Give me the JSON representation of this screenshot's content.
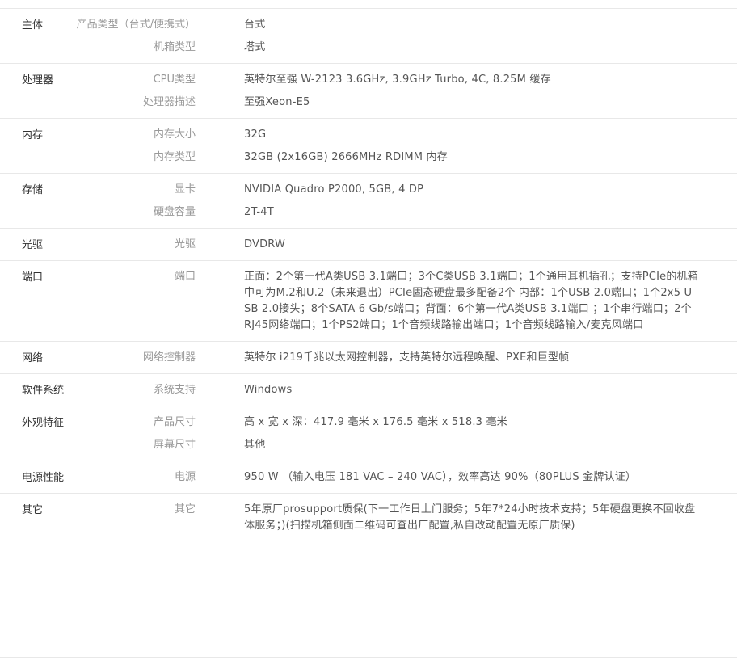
{
  "groups": [
    {
      "title": "主体",
      "rows": [
        {
          "label": "产品类型（台式/便携式）",
          "value": "台式"
        },
        {
          "label": "机箱类型",
          "value": "塔式"
        }
      ]
    },
    {
      "title": "处理器",
      "rows": [
        {
          "label": "CPU类型",
          "value": "英特尔至强 W-2123 3.6GHz, 3.9GHz Turbo, 4C, 8.25M 缓存"
        },
        {
          "label": "处理器描述",
          "value": "至强Xeon-E5"
        }
      ]
    },
    {
      "title": "内存",
      "rows": [
        {
          "label": "内存大小",
          "value": "32G"
        },
        {
          "label": "内存类型",
          "value": "32GB (2x16GB) 2666MHz RDIMM 内存"
        }
      ]
    },
    {
      "title": "存储",
      "rows": [
        {
          "label": "显卡",
          "value": "NVIDIA Quadro P2000, 5GB, 4 DP"
        },
        {
          "label": "硬盘容量",
          "value": "2T-4T"
        }
      ]
    },
    {
      "title": "光驱",
      "rows": [
        {
          "label": "光驱",
          "value": "DVDRW"
        }
      ]
    },
    {
      "title": "端口",
      "rows": [
        {
          "label": "端口",
          "value": "正面：2个第一代A类USB 3.1端口；3个C类USB 3.1端口；1个通用耳机插孔；支持PCIe的机箱中可为M.2和U.2（未来退出）PCIe固态硬盘最多配备2个 内部：1个USB 2.0端口；1个2x5 USB 2.0接头；8个SATA 6 Gb/s端口；背面：6个第一代A类USB 3.1端口 ；1个串行端口；2个RJ45网络端口；1个PS2端口；1个音频线路输出端口；1个音频线路输入/麦克风端口"
        }
      ]
    },
    {
      "title": "网络",
      "rows": [
        {
          "label": "网络控制器",
          "value": "英特尔 i219千兆以太网控制器，支持英特尔远程唤醒、PXE和巨型帧"
        }
      ]
    },
    {
      "title": "软件系统",
      "rows": [
        {
          "label": "系统支持",
          "value": "Windows"
        }
      ]
    },
    {
      "title": "外观特征",
      "rows": [
        {
          "label": "产品尺寸",
          "value": "高 x 宽 x 深：417.9 毫米 x 176.5 毫米 x 518.3 毫米"
        },
        {
          "label": "屏幕尺寸",
          "value": "其他"
        }
      ]
    },
    {
      "title": "电源性能",
      "rows": [
        {
          "label": "电源",
          "value": "950 W （输入电压 181 VAC – 240 VAC），效率高达 90%（80PLUS 金牌认证）"
        }
      ]
    },
    {
      "title": "其它",
      "rows": [
        {
          "label": "其它",
          "value": "5年原厂prosupport质保(下一工作日上门服务；5年7*24小时技术支持；5年硬盘更换不回收盘体服务；)(扫描机箱侧面二维码可查出厂配置,私自改动配置无原厂质保)"
        }
      ]
    }
  ]
}
